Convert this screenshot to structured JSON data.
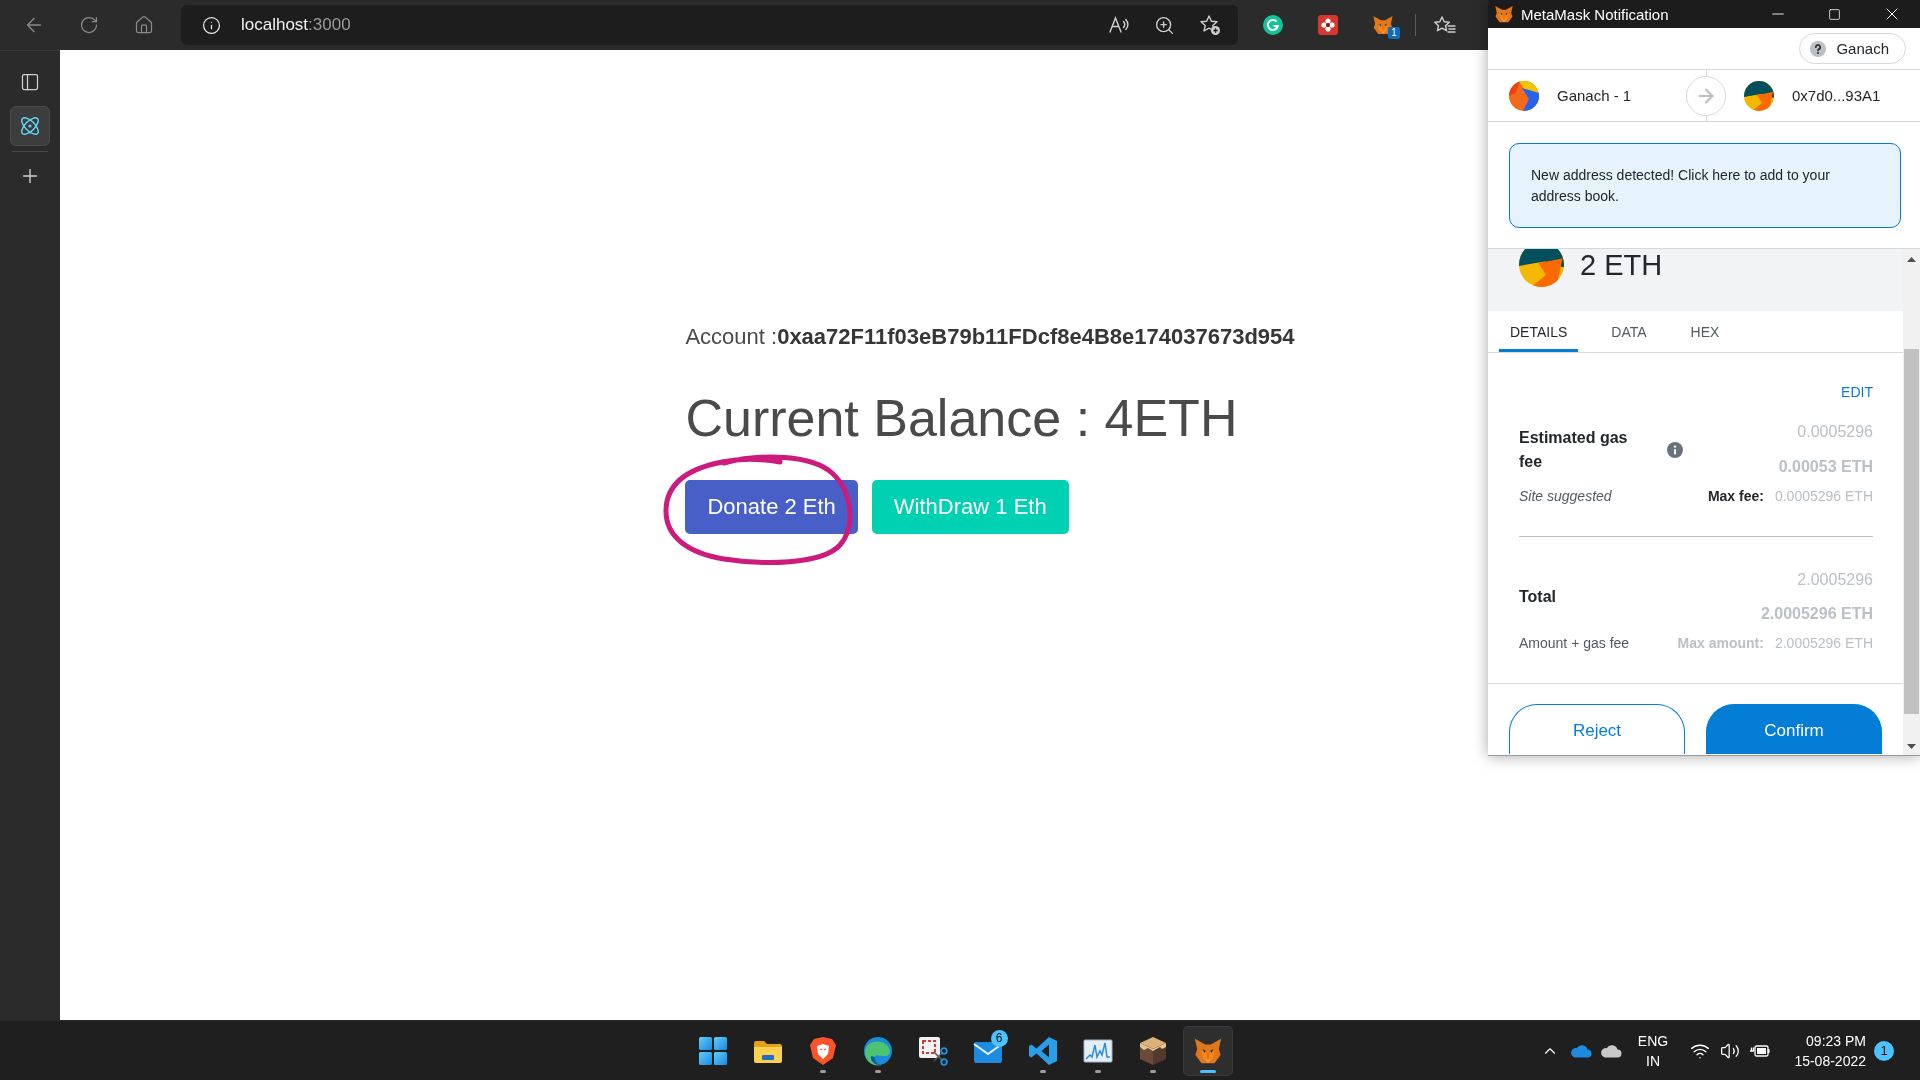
{
  "browser": {
    "host": "localhost",
    "port": ":3000",
    "extension_badge": "1"
  },
  "sidebar": {
    "items": [
      {
        "kind": "tabs",
        "selected": false
      },
      {
        "kind": "atom",
        "selected": true
      }
    ]
  },
  "page": {
    "account": "Account :**0xaa72F11f03eB79b11FDcf8e4B8e174037673d954**",
    "balance": "Current Balance : 4ETH",
    "buttons": [
      {
        "label": "Donate 2 Eth",
        "kind": "link",
        "circled": true
      },
      {
        "label": "WithDraw 1 Eth",
        "kind": "primary",
        "circled": false
      }
    ]
  },
  "metamask": {
    "title": "MetaMask Notification",
    "network": "Ganach",
    "from": "Ganach - 1",
    "to": "0x7d0...93A1",
    "alert": "New address detected! Click here to add to your address book.",
    "amount": "2 ETH",
    "tabs": [
      {
        "label": "DETAILS",
        "selected": true
      },
      {
        "label": "DATA",
        "selected": false
      },
      {
        "label": "HEX",
        "selected": false
      }
    ],
    "edit": "EDIT",
    "fees": [
      {
        "kind": "gas",
        "label": "Estimated gas fee",
        "value": "0.0005296",
        "value_eth": "0.00053 ETH",
        "note": "Site suggested",
        "max_label": "Max fee:",
        "max_value": "0.0005296 ETH"
      },
      {
        "kind": "total",
        "label": "Total",
        "value": "2.0005296",
        "value_eth": "2.0005296 ETH",
        "note": "Amount + gas fee",
        "max_label": "Max amount:",
        "max_value": "2.0005296 ETH"
      }
    ],
    "buttons": [
      {
        "label": "Reject",
        "kind": "secondary"
      },
      {
        "label": "Confirm",
        "kind": "primary"
      }
    ]
  },
  "taskbar": {
    "apps": [
      {
        "kind": "start",
        "running": false,
        "selected": false
      },
      {
        "kind": "folder",
        "running": false,
        "selected": false
      },
      {
        "kind": "shield",
        "running": true,
        "selected": false
      },
      {
        "kind": "swirl",
        "running": true,
        "selected": false
      },
      {
        "kind": "snip",
        "running": false,
        "selected": false
      },
      {
        "kind": "mail",
        "running": false,
        "selected": false,
        "badge": "6"
      },
      {
        "kind": "ribbon",
        "running": true,
        "selected": false
      },
      {
        "kind": "chart",
        "running": true,
        "selected": false
      },
      {
        "kind": "cube",
        "running": true,
        "selected": false
      },
      {
        "kind": "fox",
        "running": true,
        "selected": true
      }
    ],
    "tray": {
      "language": "ENG",
      "region": "IN",
      "time": "09:23 PM",
      "date": "15-08-2022",
      "notifications": "1"
    }
  }
}
